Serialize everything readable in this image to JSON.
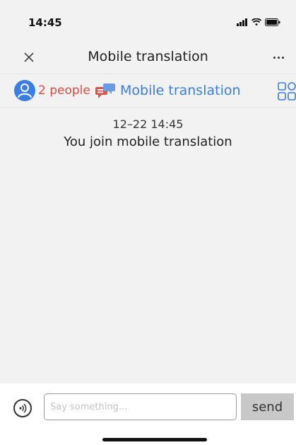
{
  "status_bar": {
    "time": "14:45",
    "icons": [
      "signal-icon",
      "wifi-icon",
      "battery-icon"
    ]
  },
  "nav": {
    "title": "Mobile translation",
    "close_icon": "close-icon",
    "more_icon": "more-icon"
  },
  "info_bar": {
    "people_label": "2 people",
    "room_label": "Mobile translation",
    "icons": [
      "people-icon",
      "chat-bubbles-icon",
      "grid-icon"
    ]
  },
  "messages": [
    {
      "time": "12–22 14:45",
      "text": "You join mobile translation"
    }
  ],
  "input_bar": {
    "placeholder": "Say something...",
    "value": "",
    "send_label": "send",
    "voice_icon": "voice-icon"
  },
  "colors": {
    "accent_blue": "#3a7ee0",
    "people_red": "#e04a43",
    "background": "#f2f2f2",
    "send_button": "#c8c8c8"
  }
}
